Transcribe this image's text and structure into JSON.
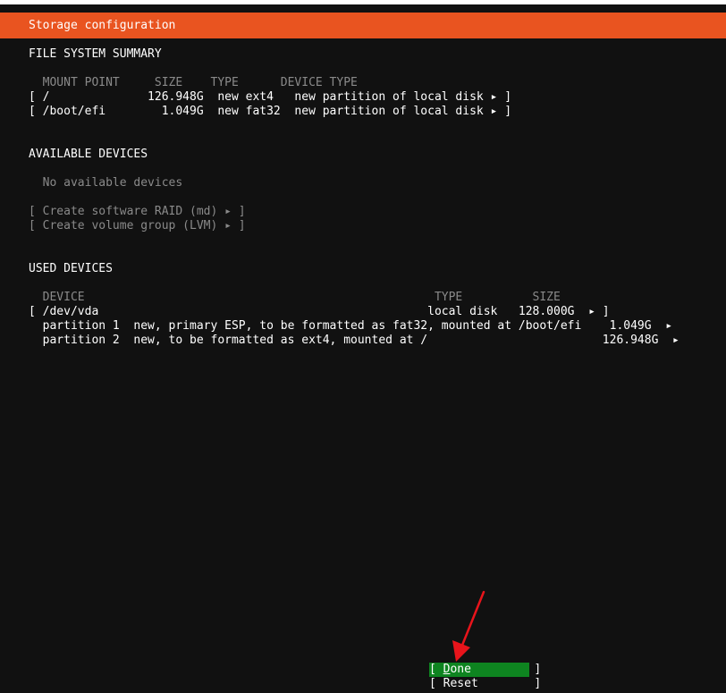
{
  "window": {
    "title": "Storage configuration"
  },
  "fs_summary": {
    "heading": "FILE SYSTEM SUMMARY",
    "header_line": "  MOUNT POINT     SIZE    TYPE      DEVICE TYPE",
    "rows": [
      "[ /              126.948G  new ext4   new partition of local disk ▸ ]",
      "[ /boot/efi        1.049G  new fat32  new partition of local disk ▸ ]"
    ]
  },
  "available": {
    "heading": "AVAILABLE DEVICES",
    "empty_text": "  No available devices",
    "actions": [
      "[ Create software RAID (md) ▸ ]",
      "[ Create volume group (LVM) ▸ ]"
    ]
  },
  "used": {
    "heading": "USED DEVICES",
    "header_line": "  DEVICE                                                  TYPE          SIZE",
    "rows": [
      "[ /dev/vda                                               local disk   128.000G  ▸ ]",
      "  partition 1  new, primary ESP, to be formatted as fat32, mounted at /boot/efi    1.049G  ▸",
      "  partition 2  new, to be formatted as ext4, mounted at /                         126.948G  ▸"
    ]
  },
  "buttons": {
    "done_open": "[ ",
    "done_hotkey": "D",
    "done_rest": "one",
    "done_close": "         ]",
    "reset": "[ Reset        ]"
  },
  "colors": {
    "title_bar": "#e95420",
    "selected_button": "#0e8420",
    "background": "#111111",
    "annotation_arrow": "#e8141b"
  }
}
